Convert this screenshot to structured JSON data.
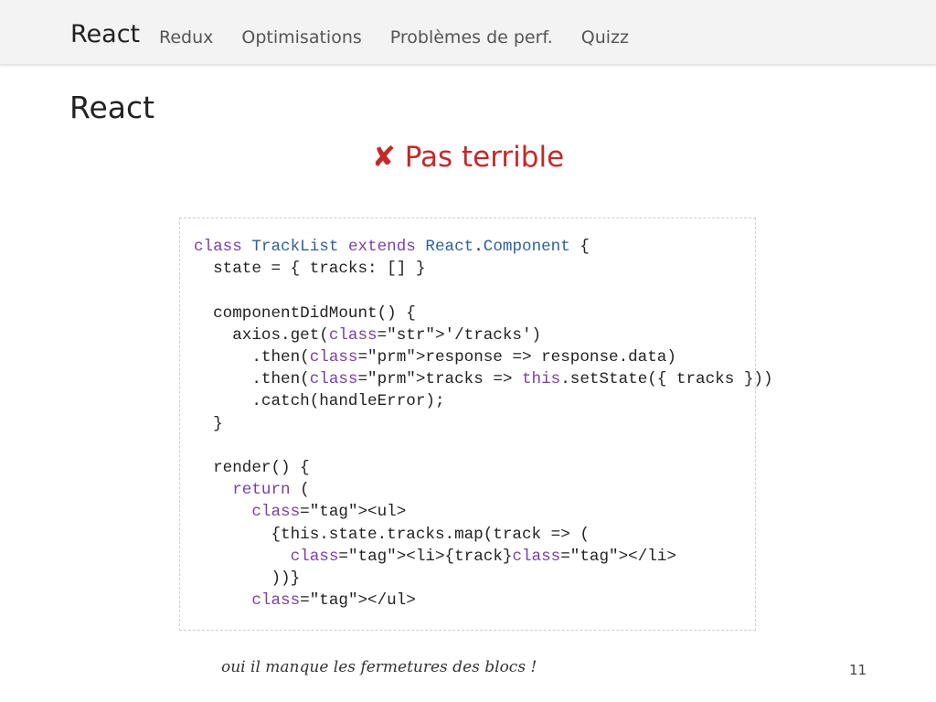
{
  "navbar": {
    "brand": "React",
    "items": [
      {
        "label": "Redux"
      },
      {
        "label": "Optimisations"
      },
      {
        "label": "Problèmes de perf."
      },
      {
        "label": "Quizz"
      }
    ]
  },
  "slide": {
    "title": "React",
    "verdict_icon": "✘",
    "verdict_text": "Pas terrible",
    "note": "oui il manque les fermetures des blocs !",
    "page_number": "11"
  },
  "code": {
    "language": "javascript",
    "lines": [
      "class TrackList extends React.Component {",
      "  state = { tracks: [] }",
      "",
      "  componentDidMount() {",
      "    axios.get('/tracks')",
      "      .then(response => response.data)",
      "      .then(tracks => this.setState({ tracks }))",
      "      .catch(handleError);",
      "  }",
      "",
      "  render() {",
      "    return (",
      "      <ul>",
      "        {this.state.tracks.map(track => (",
      "          <li>{track}</li>",
      "        ))}",
      "      </ul>"
    ]
  },
  "colors": {
    "keyword": "#7a3fa8",
    "class": "#2f5f9c",
    "string": "#5a8a1e",
    "param": "#e08a1e",
    "tag": "#c0221b",
    "verdict": "#c62828"
  }
}
